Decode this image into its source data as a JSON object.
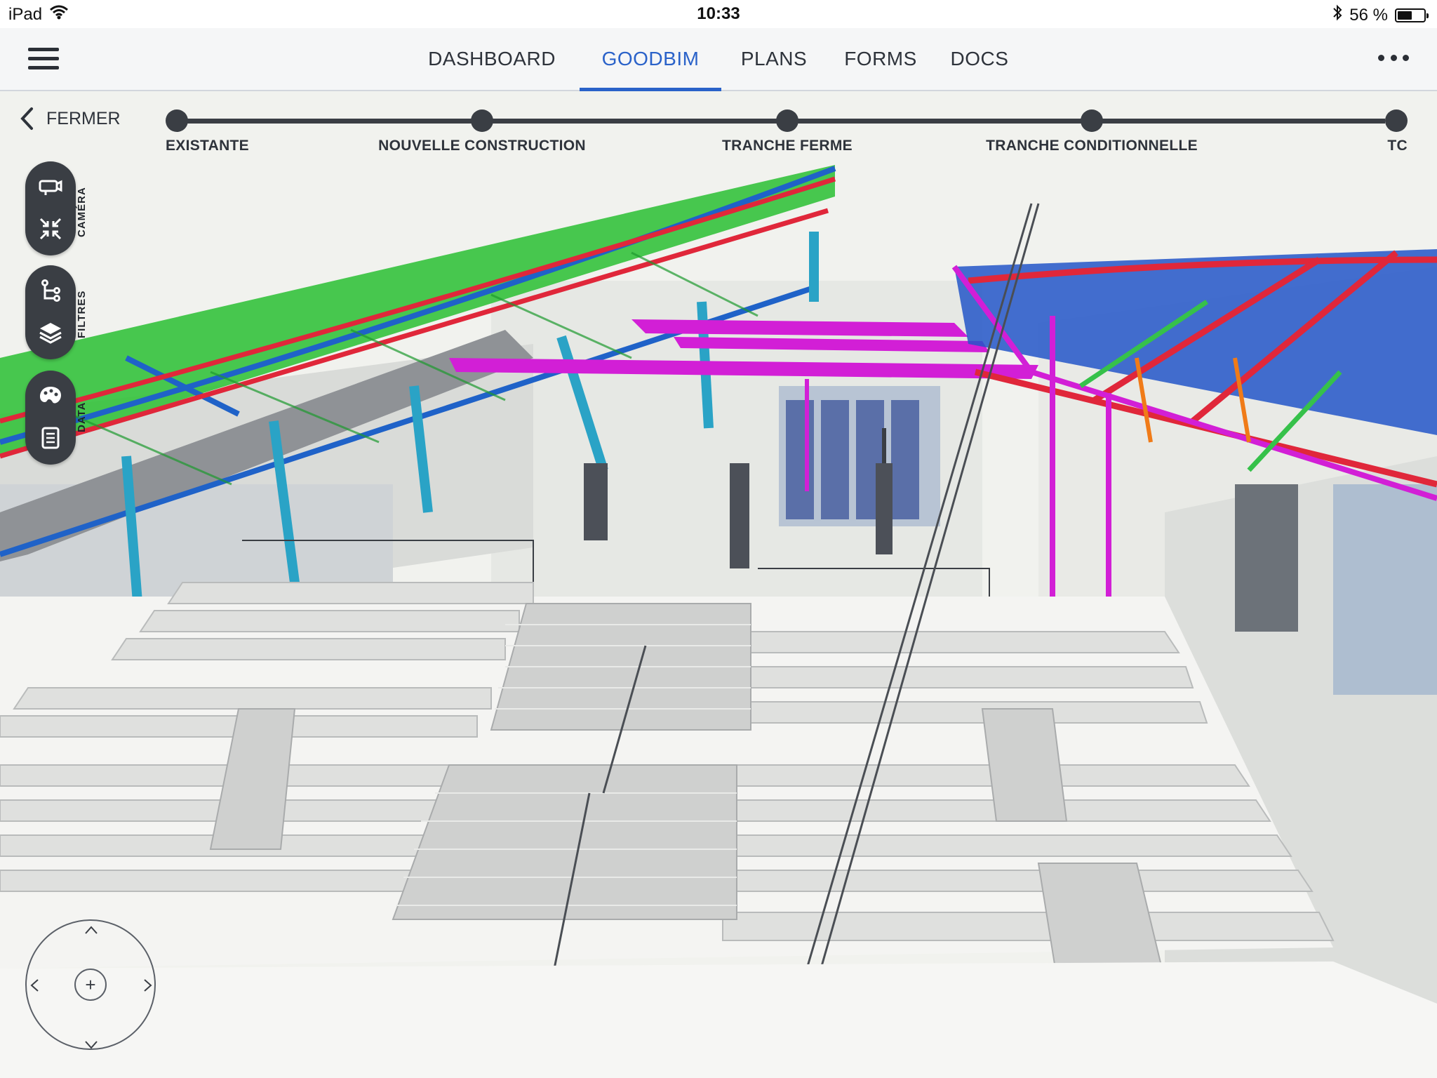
{
  "status_bar": {
    "device": "iPad",
    "time": "10:33",
    "battery_text": "56 %",
    "battery_level": 0.56
  },
  "nav": {
    "menu_icon": "hamburger-menu-icon",
    "tabs": [
      {
        "label": "DASHBOARD",
        "active": false
      },
      {
        "label": "GOODBIM",
        "active": true
      },
      {
        "label": "PLANS",
        "active": false
      },
      {
        "label": "FORMS",
        "active": false
      },
      {
        "label": "DOCS",
        "active": false
      }
    ],
    "more_icon": "more-dots-icon",
    "accent_color": "#2a62c9"
  },
  "viewer": {
    "close_label": "FERMER",
    "phases": [
      {
        "label": "EXISTANTE"
      },
      {
        "label": "NOUVELLE CONSTRUCTION"
      },
      {
        "label": "TRANCHE FERME"
      },
      {
        "label": "TRANCHE CONDITIONNELLE"
      },
      {
        "label": "TC"
      }
    ],
    "tool_groups": [
      {
        "label": "CAMÉRA",
        "icons": [
          "camera-icon",
          "fit-view-icon"
        ]
      },
      {
        "label": "FILTRES",
        "icons": [
          "filter-tree-icon",
          "layers-icon"
        ]
      },
      {
        "label": "DATA",
        "icons": [
          "palette-icon",
          "document-icon"
        ]
      }
    ],
    "joystick": {
      "center_symbol": "+",
      "icons": [
        "arrow-up-icon",
        "arrow-down-icon",
        "arrow-left-icon",
        "arrow-right-icon"
      ]
    }
  }
}
